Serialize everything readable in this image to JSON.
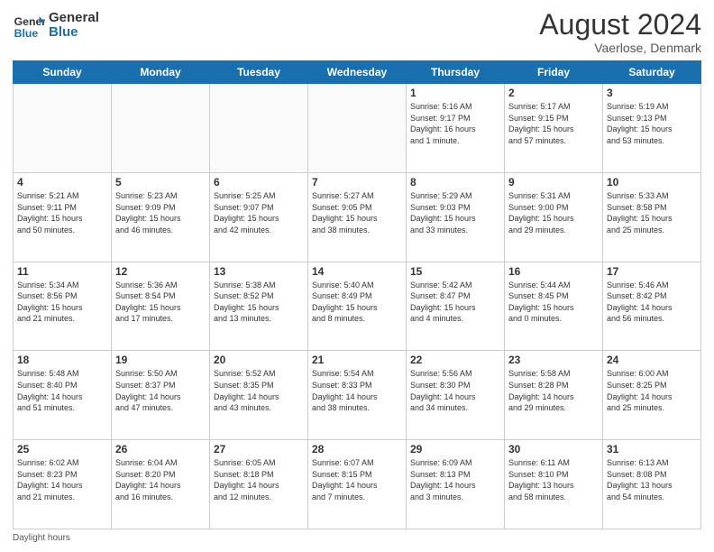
{
  "header": {
    "logo_text_general": "General",
    "logo_text_blue": "Blue",
    "month_year": "August 2024",
    "location": "Vaerlose, Denmark"
  },
  "days_of_week": [
    "Sunday",
    "Monday",
    "Tuesday",
    "Wednesday",
    "Thursday",
    "Friday",
    "Saturday"
  ],
  "weeks": [
    [
      {
        "day": "",
        "info": ""
      },
      {
        "day": "",
        "info": ""
      },
      {
        "day": "",
        "info": ""
      },
      {
        "day": "",
        "info": ""
      },
      {
        "day": "1",
        "info": "Sunrise: 5:16 AM\nSunset: 9:17 PM\nDaylight: 16 hours\nand 1 minute."
      },
      {
        "day": "2",
        "info": "Sunrise: 5:17 AM\nSunset: 9:15 PM\nDaylight: 15 hours\nand 57 minutes."
      },
      {
        "day": "3",
        "info": "Sunrise: 5:19 AM\nSunset: 9:13 PM\nDaylight: 15 hours\nand 53 minutes."
      }
    ],
    [
      {
        "day": "4",
        "info": "Sunrise: 5:21 AM\nSunset: 9:11 PM\nDaylight: 15 hours\nand 50 minutes."
      },
      {
        "day": "5",
        "info": "Sunrise: 5:23 AM\nSunset: 9:09 PM\nDaylight: 15 hours\nand 46 minutes."
      },
      {
        "day": "6",
        "info": "Sunrise: 5:25 AM\nSunset: 9:07 PM\nDaylight: 15 hours\nand 42 minutes."
      },
      {
        "day": "7",
        "info": "Sunrise: 5:27 AM\nSunset: 9:05 PM\nDaylight: 15 hours\nand 38 minutes."
      },
      {
        "day": "8",
        "info": "Sunrise: 5:29 AM\nSunset: 9:03 PM\nDaylight: 15 hours\nand 33 minutes."
      },
      {
        "day": "9",
        "info": "Sunrise: 5:31 AM\nSunset: 9:00 PM\nDaylight: 15 hours\nand 29 minutes."
      },
      {
        "day": "10",
        "info": "Sunrise: 5:33 AM\nSunset: 8:58 PM\nDaylight: 15 hours\nand 25 minutes."
      }
    ],
    [
      {
        "day": "11",
        "info": "Sunrise: 5:34 AM\nSunset: 8:56 PM\nDaylight: 15 hours\nand 21 minutes."
      },
      {
        "day": "12",
        "info": "Sunrise: 5:36 AM\nSunset: 8:54 PM\nDaylight: 15 hours\nand 17 minutes."
      },
      {
        "day": "13",
        "info": "Sunrise: 5:38 AM\nSunset: 8:52 PM\nDaylight: 15 hours\nand 13 minutes."
      },
      {
        "day": "14",
        "info": "Sunrise: 5:40 AM\nSunset: 8:49 PM\nDaylight: 15 hours\nand 8 minutes."
      },
      {
        "day": "15",
        "info": "Sunrise: 5:42 AM\nSunset: 8:47 PM\nDaylight: 15 hours\nand 4 minutes."
      },
      {
        "day": "16",
        "info": "Sunrise: 5:44 AM\nSunset: 8:45 PM\nDaylight: 15 hours\nand 0 minutes."
      },
      {
        "day": "17",
        "info": "Sunrise: 5:46 AM\nSunset: 8:42 PM\nDaylight: 14 hours\nand 56 minutes."
      }
    ],
    [
      {
        "day": "18",
        "info": "Sunrise: 5:48 AM\nSunset: 8:40 PM\nDaylight: 14 hours\nand 51 minutes."
      },
      {
        "day": "19",
        "info": "Sunrise: 5:50 AM\nSunset: 8:37 PM\nDaylight: 14 hours\nand 47 minutes."
      },
      {
        "day": "20",
        "info": "Sunrise: 5:52 AM\nSunset: 8:35 PM\nDaylight: 14 hours\nand 43 minutes."
      },
      {
        "day": "21",
        "info": "Sunrise: 5:54 AM\nSunset: 8:33 PM\nDaylight: 14 hours\nand 38 minutes."
      },
      {
        "day": "22",
        "info": "Sunrise: 5:56 AM\nSunset: 8:30 PM\nDaylight: 14 hours\nand 34 minutes."
      },
      {
        "day": "23",
        "info": "Sunrise: 5:58 AM\nSunset: 8:28 PM\nDaylight: 14 hours\nand 29 minutes."
      },
      {
        "day": "24",
        "info": "Sunrise: 6:00 AM\nSunset: 8:25 PM\nDaylight: 14 hours\nand 25 minutes."
      }
    ],
    [
      {
        "day": "25",
        "info": "Sunrise: 6:02 AM\nSunset: 8:23 PM\nDaylight: 14 hours\nand 21 minutes."
      },
      {
        "day": "26",
        "info": "Sunrise: 6:04 AM\nSunset: 8:20 PM\nDaylight: 14 hours\nand 16 minutes."
      },
      {
        "day": "27",
        "info": "Sunrise: 6:05 AM\nSunset: 8:18 PM\nDaylight: 14 hours\nand 12 minutes."
      },
      {
        "day": "28",
        "info": "Sunrise: 6:07 AM\nSunset: 8:15 PM\nDaylight: 14 hours\nand 7 minutes."
      },
      {
        "day": "29",
        "info": "Sunrise: 6:09 AM\nSunset: 8:13 PM\nDaylight: 14 hours\nand 3 minutes."
      },
      {
        "day": "30",
        "info": "Sunrise: 6:11 AM\nSunset: 8:10 PM\nDaylight: 13 hours\nand 58 minutes."
      },
      {
        "day": "31",
        "info": "Sunrise: 6:13 AM\nSunset: 8:08 PM\nDaylight: 13 hours\nand 54 minutes."
      }
    ]
  ],
  "footer": {
    "daylight_label": "Daylight hours"
  }
}
